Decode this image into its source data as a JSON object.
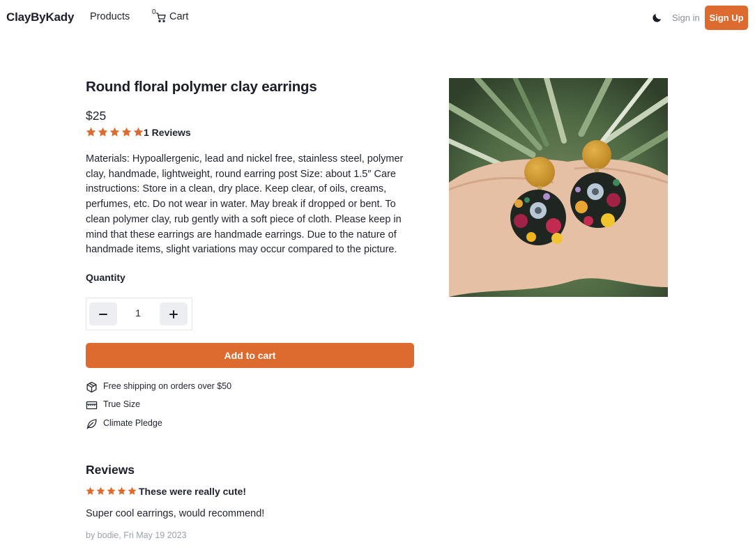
{
  "header": {
    "brand": "ClayByKady",
    "nav_products": "Products",
    "cart_count": "0",
    "cart_label": "Cart",
    "sign_in": "Sign in",
    "sign_up": "Sign Up",
    "theme_icon": "moon-icon"
  },
  "product": {
    "title": "Round floral polymer clay earrings",
    "price": "$25",
    "rating": 5,
    "reviews_label": "1 Reviews",
    "description": "Materials: Hypoallergenic, lead and nickel free, stainless steel, polymer clay, handmade, lightweight, round earring post Size: about 1.5″ Care instructions: Store in a clean, dry place. Keep clear, of oils, creams, perfumes, etc. Do not wear in water. May break if dropped or bent. To clean polymer clay, rub gently with a soft piece of cloth. Please keep in mind that these earrings are handmade earrings. Due to the nature of handmade items, slight variations may occur compared to the picture.",
    "quantity_label": "Quantity",
    "quantity_value": "1",
    "add_to_cart": "Add to cart",
    "features": [
      {
        "icon": "box-icon",
        "label": "Free shipping on orders over $50"
      },
      {
        "icon": "ruler-icon",
        "label": "True Size"
      },
      {
        "icon": "leaf-icon",
        "label": "Climate Pledge"
      }
    ],
    "image_icon": "product-photo"
  },
  "reviews": {
    "heading": "Reviews",
    "items": [
      {
        "rating": 5,
        "title": "These were really cute!",
        "body": "Super cool earrings, would recommend!",
        "meta": "by bodie, Fri May 19 2023"
      }
    ]
  },
  "colors": {
    "accent": "#dd6b2f",
    "text": "#1f2330",
    "muted": "#9aa0ab"
  }
}
